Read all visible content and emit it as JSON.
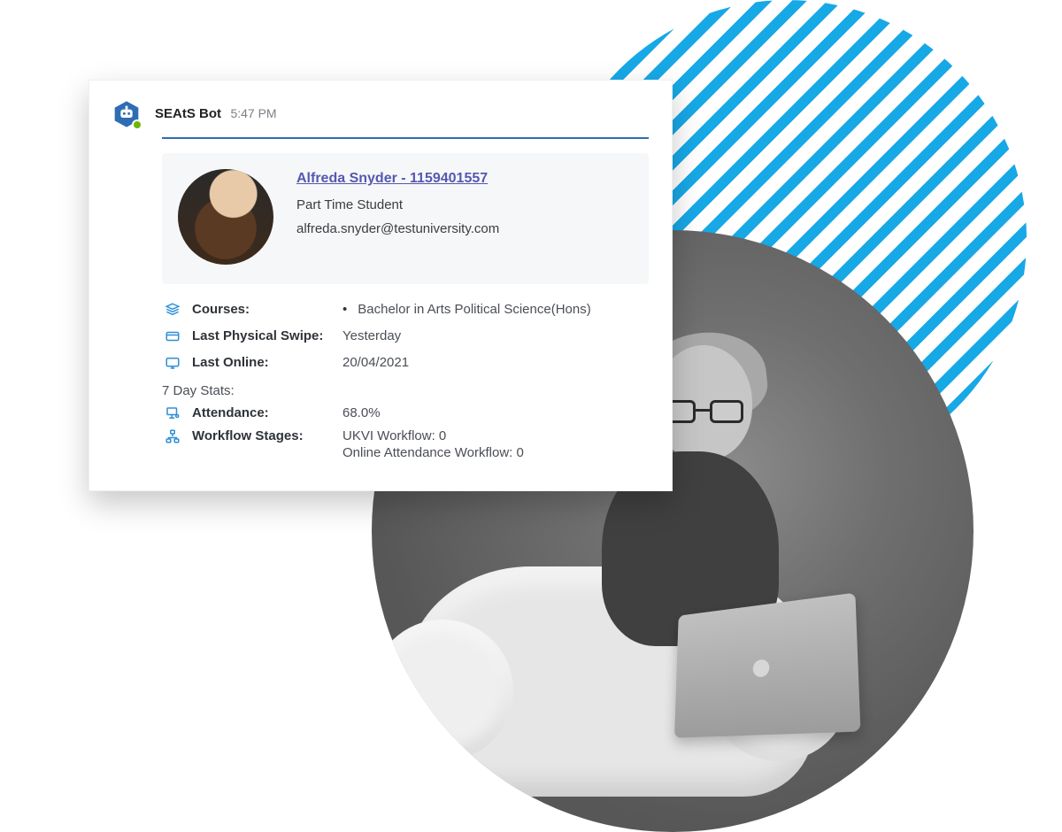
{
  "colors": {
    "accent": "#17a8e6",
    "link": "#5558af",
    "divider": "#2e6db4",
    "icon": "#2e8fd6"
  },
  "bot": {
    "name": "SEAtS Bot",
    "time": "5:47 PM",
    "status": "available"
  },
  "student": {
    "link_text": "Alfreda Snyder - 1159401557",
    "role": "Part Time Student",
    "email": "alfreda.snyder@testuniversity.com"
  },
  "fields": {
    "courses_label": "Courses:",
    "courses_value": "Bachelor in Arts Political Science(Hons)",
    "last_swipe_label": "Last Physical Swipe:",
    "last_swipe_value": "Yesterday",
    "last_online_label": "Last Online:",
    "last_online_value": "20/04/2021",
    "stats_heading": "7 Day Stats:",
    "attendance_label": "Attendance:",
    "attendance_value": "68.0%",
    "workflow_label": "Workflow Stages:",
    "workflow_line1": "UKVI Workflow: 0",
    "workflow_line2": "Online Attendance Workflow: 0"
  }
}
